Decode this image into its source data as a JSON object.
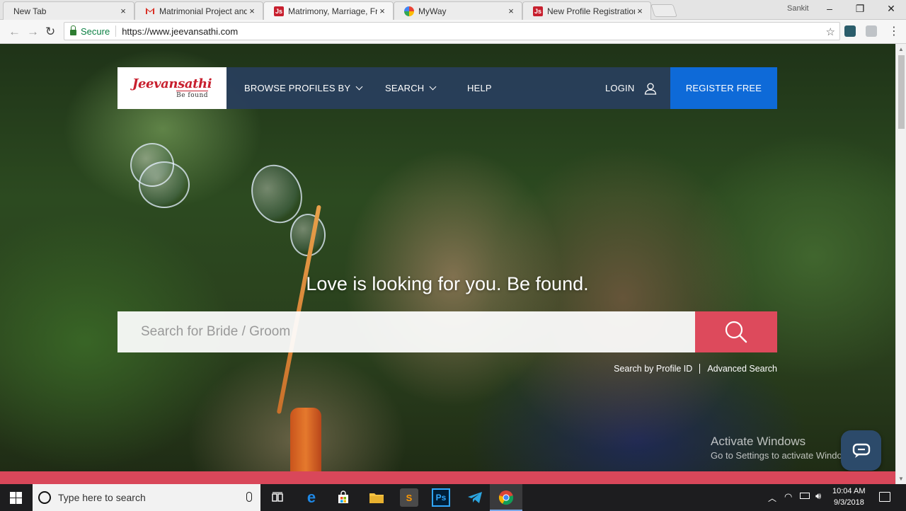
{
  "browser": {
    "tabs": [
      {
        "title": "New Tab",
        "favicon": "blank-icon",
        "active": false
      },
      {
        "title": "Matrimonial Project and",
        "favicon": "gmail-icon",
        "active": false
      },
      {
        "title": "Matrimony, Marriage, Fre",
        "favicon": "jeevansathi-icon",
        "active": true
      },
      {
        "title": "MyWay",
        "favicon": "myway-icon",
        "active": false
      },
      {
        "title": "New Profile Registration",
        "favicon": "jeevansathi-icon",
        "active": false
      }
    ],
    "close_glyph": "×",
    "profile_name": "Sankit",
    "secure_label": "Secure",
    "url": "https://www.jeevansathi.com",
    "colors": {
      "secure": "#0b8043"
    }
  },
  "site": {
    "logo_text": "Jeevansathi",
    "logo_tagline": "Be found",
    "nav": {
      "browse": "BROWSE PROFILES BY",
      "search": "SEARCH",
      "help": "HELP",
      "login": "LOGIN",
      "register": "REGISTER FREE"
    },
    "tagline": "Love is looking for you. Be found.",
    "search_placeholder": "Search for Bride / Groom",
    "search_by_id": "Search by Profile ID",
    "advanced_search": "Advanced Search",
    "colors": {
      "brand_red": "#c8202f",
      "header": "#293e5c",
      "register_blue": "#0e6ad8",
      "search_btn": "#dd4a5c",
      "pink_strip": "#d9475a"
    }
  },
  "watermark": {
    "line1": "Activate Windows",
    "line2": "Go to Settings to activate Windows."
  },
  "taskbar": {
    "search_placeholder": "Type here to search",
    "time": "10:04 AM",
    "date": "9/3/2018",
    "apps": [
      "task-view-icon",
      "edge-icon",
      "store-icon",
      "file-explorer-icon",
      "sublime-icon",
      "photoshop-icon",
      "telegram-icon",
      "chrome-icon"
    ],
    "photoshop_label": "Ps"
  }
}
